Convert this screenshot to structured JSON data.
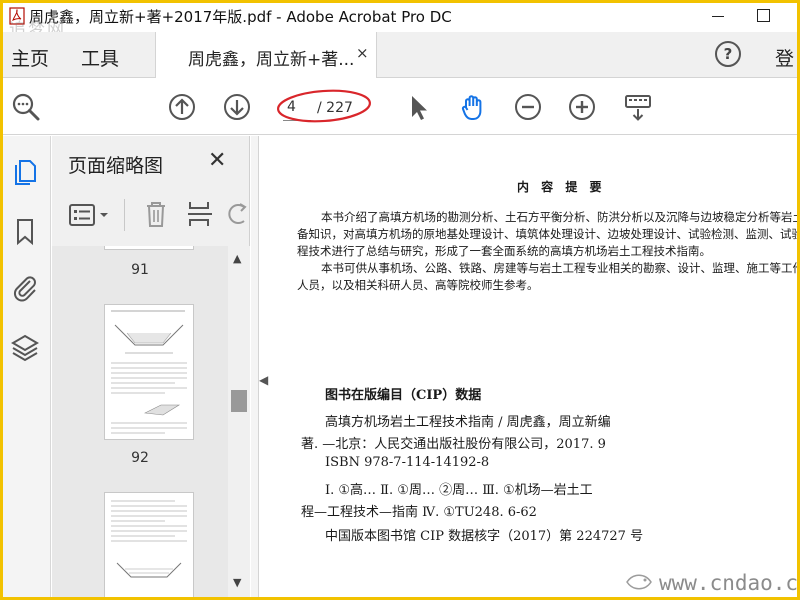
{
  "window": {
    "title": "周虎鑫，周立新+著+2017年版.pdf - Adobe Acrobat Pro DC"
  },
  "menu": {
    "home_label": "主页",
    "tools_label": "工具",
    "doc_tab_label": "周虎鑫，周立新+著...",
    "tab_close": "×",
    "help": "?",
    "signin_label": "登"
  },
  "toolbar": {
    "page_current": "4",
    "page_total": "/ 227",
    "icons": [
      "zoom-search-icon",
      "page-up-icon",
      "page-down-icon",
      "select-cursor-icon",
      "hand-tool-icon",
      "zoom-out-icon",
      "zoom-in-icon",
      "keyboard-tools-icon"
    ],
    "highlight_color": "#d9262b",
    "accent_color": "#1473e6"
  },
  "left_rail": {
    "icons": [
      "page-thumbnails-icon",
      "bookmark-icon",
      "attachment-icon",
      "layers-icon"
    ]
  },
  "thumbnails_panel": {
    "title": "页面缩略图",
    "close": "✕",
    "page_labels": [
      "91",
      "92"
    ]
  },
  "document": {
    "heading": "内 容 提 要",
    "summary_lines": [
      "本书介绍了高填方机场的勘测分析、土石方平衡分析、防洪分析以及沉降与边坡稳定分析等岩土工",
      "备知识，对高填方机场的原地基处理设计、填筑体处理设计、边坡处理设计、试验检测、监测、试验段等分",
      "程技术进行了总结与研究，形成了一套全面系统的高填方机场岩土工程技术指南。",
      "本书可供从事机场、公路、铁路、房建等与岩土工程专业相关的勘察、设计、监理、施工等工作的工程",
      "人员，以及相关科研人员、高等院校师生参考。"
    ],
    "cip_heading": "图书在版编目（CIP）数据",
    "cip_lines": [
      "高填方机场岩土工程技术指南 / 周虎鑫，周立新编",
      "著. —北京：人民交通出版社股份有限公司，2017. 9",
      "ISBN 978-7-114-14192-8",
      "Ⅰ. ①高… Ⅱ. ①周… ②周… Ⅲ. ①机场—岩土工",
      "程—工程技术—指南 Ⅳ. ①TU248. 6-62",
      "中国版本图书馆 CIP 数据核字（2017）第 224727 号"
    ]
  },
  "watermarks": {
    "top_left": "追梦网",
    "bottom_right": "www.cndao.com"
  }
}
